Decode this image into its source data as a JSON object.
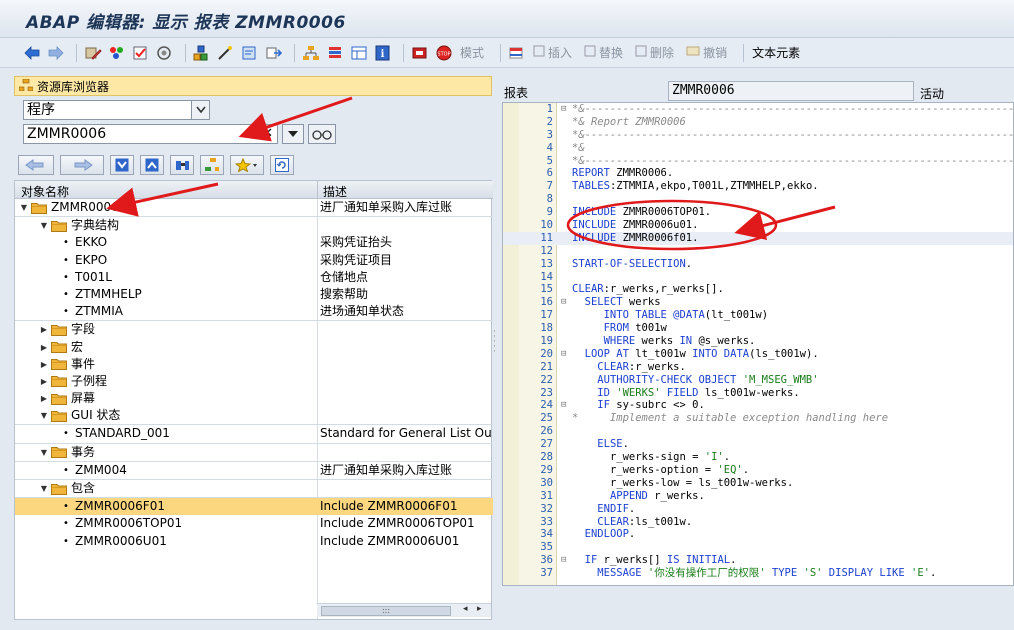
{
  "window": {
    "title": "ABAP 编辑器: 显示 报表 ZMMR0006"
  },
  "toolbar": {
    "mode_label": "模式",
    "insert_label": "插入",
    "replace_label": "替换",
    "delete_label": "删除",
    "undo_label": "撤销",
    "text_elements_label": "文本元素"
  },
  "repo": {
    "header": "资源库浏览器",
    "object_type": "程序",
    "object_name": "ZMMR0006",
    "clear_glyph": "✕"
  },
  "tree": {
    "col_name": "对象名称",
    "col_desc": "描述",
    "rows": [
      {
        "name": "ZMMR0006",
        "desc": "进厂通知单采购入库过账"
      },
      {
        "name": "字典结构",
        "desc": ""
      },
      {
        "name": "EKKO",
        "desc": "采购凭证抬头"
      },
      {
        "name": "EKPO",
        "desc": "采购凭证项目"
      },
      {
        "name": "T001L",
        "desc": "仓储地点"
      },
      {
        "name": "ZTMMHELP",
        "desc": "搜索帮助"
      },
      {
        "name": "ZTMMIA",
        "desc": "进场通知单状态"
      },
      {
        "name": "字段",
        "desc": ""
      },
      {
        "name": "宏",
        "desc": ""
      },
      {
        "name": "事件",
        "desc": ""
      },
      {
        "name": "子例程",
        "desc": ""
      },
      {
        "name": "屏幕",
        "desc": ""
      },
      {
        "name": "GUI 状态",
        "desc": ""
      },
      {
        "name": "STANDARD_001",
        "desc": "Standard for General List Outpu"
      },
      {
        "name": "事务",
        "desc": ""
      },
      {
        "name": "ZMM004",
        "desc": "进厂通知单采购入库过账"
      },
      {
        "name": "包含",
        "desc": ""
      },
      {
        "name": "ZMMR0006F01",
        "desc": "Include ZMMR0006F01"
      },
      {
        "name": "ZMMR0006TOP01",
        "desc": "Include ZMMR0006TOP01"
      },
      {
        "name": "ZMMR0006U01",
        "desc": "Include ZMMR0006U01"
      }
    ]
  },
  "editor": {
    "type_label": "报表",
    "program_name": "ZMMR0006",
    "status_label": "活动",
    "lines": [
      {
        "n": "1",
        "t": "*&---------------------------------------------------------------------"
      },
      {
        "n": "2",
        "t": "*& Report ZMMR0006"
      },
      {
        "n": "3",
        "t": "*&---------------------------------------------------------------------"
      },
      {
        "n": "4",
        "t": "*&"
      },
      {
        "n": "5",
        "t": "*&---------------------------------------------------------------------"
      },
      {
        "n": "6",
        "t": "REPORT ZMMR0006."
      },
      {
        "n": "7",
        "t": "TABLES:ZTMMIA,ekpo,T001L,ZTMMHELP,ekko."
      },
      {
        "n": "8",
        "t": ""
      },
      {
        "n": "9",
        "t": "INCLUDE ZMMR0006TOP01."
      },
      {
        "n": "10",
        "t": "INCLUDE ZMMR0006u01."
      },
      {
        "n": "11",
        "t": "INCLUDE ZMMR0006f01."
      },
      {
        "n": "12",
        "t": ""
      },
      {
        "n": "13",
        "t": "START-OF-SELECTION."
      },
      {
        "n": "14",
        "t": ""
      },
      {
        "n": "15",
        "t": "CLEAR:r_werks,r_werks[]."
      },
      {
        "n": "16",
        "t": "  SELECT werks"
      },
      {
        "n": "17",
        "t": "     INTO TABLE @DATA(lt_t001w)"
      },
      {
        "n": "18",
        "t": "     FROM t001w"
      },
      {
        "n": "19",
        "t": "     WHERE werks IN @s_werks."
      },
      {
        "n": "20",
        "t": "  LOOP AT lt_t001w INTO DATA(ls_t001w)."
      },
      {
        "n": "21",
        "t": "    CLEAR:r_werks."
      },
      {
        "n": "22",
        "t": "    AUTHORITY-CHECK OBJECT 'M_MSEG_WMB'"
      },
      {
        "n": "23",
        "t": "    ID 'WERKS' FIELD ls_t001w-werks."
      },
      {
        "n": "24",
        "t": "    IF sy-subrc <> 0."
      },
      {
        "n": "25",
        "t": "*     Implement a suitable exception handling here"
      },
      {
        "n": "26",
        "t": ""
      },
      {
        "n": "27",
        "t": "    ELSE."
      },
      {
        "n": "28",
        "t": "      r_werks-sign = 'I'."
      },
      {
        "n": "29",
        "t": "      r_werks-option = 'EQ'."
      },
      {
        "n": "30",
        "t": "      r_werks-low = ls_t001w-werks."
      },
      {
        "n": "31",
        "t": "      APPEND r_werks."
      },
      {
        "n": "32",
        "t": "    ENDIF."
      },
      {
        "n": "33",
        "t": "    CLEAR:ls_t001w."
      },
      {
        "n": "34",
        "t": "  ENDLOOP."
      },
      {
        "n": "35",
        "t": ""
      },
      {
        "n": "36",
        "t": "  IF r_werks[] IS INITIAL."
      },
      {
        "n": "37",
        "t": "    MESSAGE '你没有操作工厂的权限' TYPE 'S' DISPLAY LIKE 'E'."
      }
    ]
  },
  "colors": {
    "accent_yellow": "#fcd77f",
    "keyword_blue": "#1b3fd1",
    "annotation_red": "#e0191b",
    "line_number_blue": "#2a5cad"
  }
}
